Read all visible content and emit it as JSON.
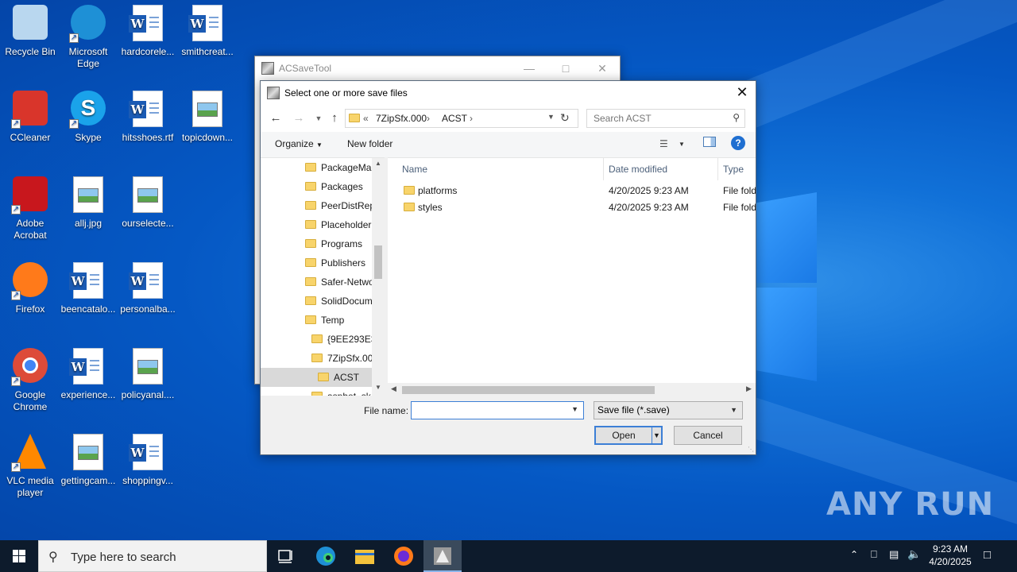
{
  "desktop": {
    "icons": [
      {
        "label": "Recycle Bin",
        "kind": "recycle-bin-icon"
      },
      {
        "label": "Microsoft Edge",
        "kind": "edge-icon"
      },
      {
        "label": "hardcorele...",
        "kind": "word-doc-icon"
      },
      {
        "label": "smithcreat...",
        "kind": "word-doc-icon"
      },
      {
        "label": "CCleaner",
        "kind": "ccleaner-icon"
      },
      {
        "label": "Skype",
        "kind": "skype-icon"
      },
      {
        "label": "hitsshoes.rtf",
        "kind": "word-doc-icon"
      },
      {
        "label": "topicdown...",
        "kind": "image-file-icon"
      },
      {
        "label": "Adobe Acrobat",
        "kind": "acrobat-icon"
      },
      {
        "label": "allj.jpg",
        "kind": "image-file-icon"
      },
      {
        "label": "ourselecte...",
        "kind": "image-file-icon"
      },
      {
        "label": "Firefox",
        "kind": "firefox-icon"
      },
      {
        "label": "beencatalo...",
        "kind": "word-doc-icon"
      },
      {
        "label": "personalba...",
        "kind": "word-doc-icon"
      },
      {
        "label": "Google Chrome",
        "kind": "chrome-icon"
      },
      {
        "label": "experience...",
        "kind": "word-doc-icon"
      },
      {
        "label": "policyanal....",
        "kind": "image-file-icon"
      },
      {
        "label": "VLC media player",
        "kind": "vlc-icon"
      },
      {
        "label": "gettingcam...",
        "kind": "image-file-icon"
      },
      {
        "label": "shoppingv...",
        "kind": "word-doc-icon"
      }
    ],
    "watermark": "ANY RUN"
  },
  "background_window": {
    "title": "ACSaveTool"
  },
  "dialog": {
    "title": "Select one or more save files",
    "address": {
      "overflow": "«",
      "segments": [
        "7ZipSfx.000",
        "ACST"
      ]
    },
    "search_placeholder": "Search ACST",
    "organize_label": "Organize",
    "new_folder_label": "New folder",
    "tree": [
      {
        "label": "PackageMa",
        "indent": 0,
        "selected": false
      },
      {
        "label": "Packages",
        "indent": 0,
        "selected": false
      },
      {
        "label": "PeerDistRep",
        "indent": 0,
        "selected": false
      },
      {
        "label": "Placeholder",
        "indent": 0,
        "selected": false
      },
      {
        "label": "Programs",
        "indent": 0,
        "selected": false
      },
      {
        "label": "Publishers",
        "indent": 0,
        "selected": false
      },
      {
        "label": "Safer-Netwo",
        "indent": 0,
        "selected": false
      },
      {
        "label": "SolidDocum",
        "indent": 0,
        "selected": false
      },
      {
        "label": "Temp",
        "indent": 0,
        "selected": false
      },
      {
        "label": "{9EE293E3-",
        "indent": 1,
        "selected": false
      },
      {
        "label": "7ZipSfx.00",
        "indent": 1,
        "selected": false
      },
      {
        "label": "ACST",
        "indent": 2,
        "selected": true
      },
      {
        "label": "aspbot_sk",
        "indent": 1,
        "selected": false
      }
    ],
    "columns": [
      "Name",
      "Date modified",
      "Type"
    ],
    "files": [
      {
        "name": "platforms",
        "date": "4/20/2025 9:23 AM",
        "type": "File fold"
      },
      {
        "name": "styles",
        "date": "4/20/2025 9:23 AM",
        "type": "File fold"
      }
    ],
    "file_name_label": "File name:",
    "file_name_value": "",
    "file_type_value": "Save file (*.save)",
    "open_label": "Open",
    "cancel_label": "Cancel"
  },
  "taskbar": {
    "search_placeholder": "Type here to search",
    "time": "9:23 AM",
    "date": "4/20/2025"
  }
}
